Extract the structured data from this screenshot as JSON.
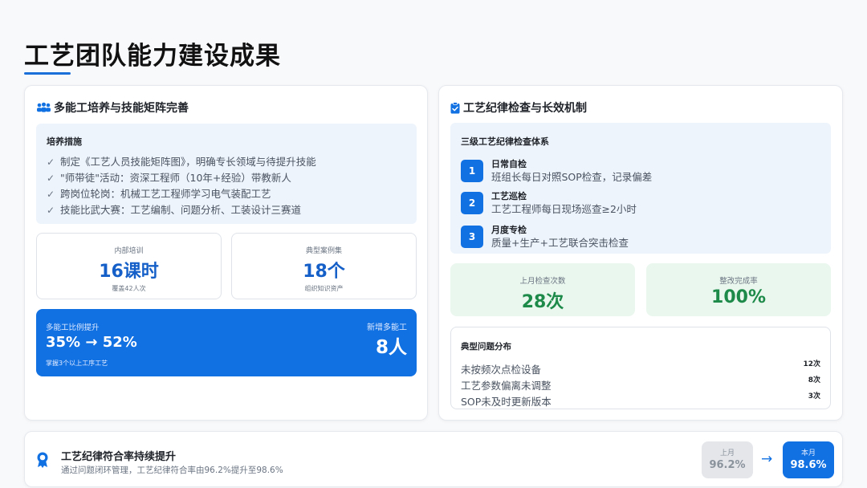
{
  "page": {
    "title": "工艺团队能力建设成果"
  },
  "left": {
    "header": "多能工培养与技能矩阵完善",
    "measures": {
      "title": "培养措施",
      "items": [
        "制定《工艺人员技能矩阵图》，明确专长领域与待提升技能",
        "\"师带徒\"活动：资深工程师（10年+经验）带教新人",
        "跨岗位轮岗：机械工艺工程师学习电气装配工艺",
        "技能比武大赛：工艺编制、问题分析、工装设计三赛道"
      ]
    },
    "training": {
      "label": "内部培训",
      "value": "16课时",
      "note": "覆盖42人次"
    },
    "cases": {
      "label": "典型案例集",
      "value": "18个",
      "note": "组织知识资产"
    },
    "multiskill": {
      "label": "多能工比例提升",
      "value": "35% → 52%",
      "note": "掌握3个以上工序工艺",
      "right_label": "新增多能工",
      "right_value": "8人"
    }
  },
  "right": {
    "header": "工艺纪律检查与长效机制",
    "system": {
      "title": "三级工艺纪律检查体系",
      "steps": [
        {
          "num": "1",
          "name": "日常自检",
          "desc": "班组长每日对照SOP检查，记录偏差"
        },
        {
          "num": "2",
          "name": "工艺巡检",
          "desc": "工艺工程师每日现场巡查≥2小时"
        },
        {
          "num": "3",
          "name": "月度专检",
          "desc": "质量+生产+工艺联合突击检查"
        }
      ]
    },
    "checks": {
      "label": "上月检查次数",
      "value": "28次"
    },
    "rate": {
      "label": "整改完成率",
      "value": "100%"
    },
    "issues": {
      "title": "典型问题分布",
      "rows": [
        {
          "label": "未按频次点检设备",
          "count": "12次"
        },
        {
          "label": "工艺参数偏离未调整",
          "count": "8次"
        },
        {
          "label": "SOP未及时更新版本",
          "count": "3次"
        }
      ]
    }
  },
  "bottom": {
    "title": "工艺纪律符合率持续提升",
    "desc": "通过问题闭环管理，工艺纪律符合率由96.2%提升至98.6%",
    "prev": {
      "label": "上月",
      "value": "96.2%"
    },
    "arrow": "→",
    "curr": {
      "label": "本月",
      "value": "98.6%"
    }
  },
  "colors": {
    "accent": "#1170e2",
    "success": "#1e8a4a",
    "light_blue_bg": "#eef4fc",
    "light_green_bg": "#eaf7ee"
  },
  "icons": {
    "left_header": "users-icon",
    "right_header": "clipboard-check-icon",
    "bottom": "award-icon"
  }
}
